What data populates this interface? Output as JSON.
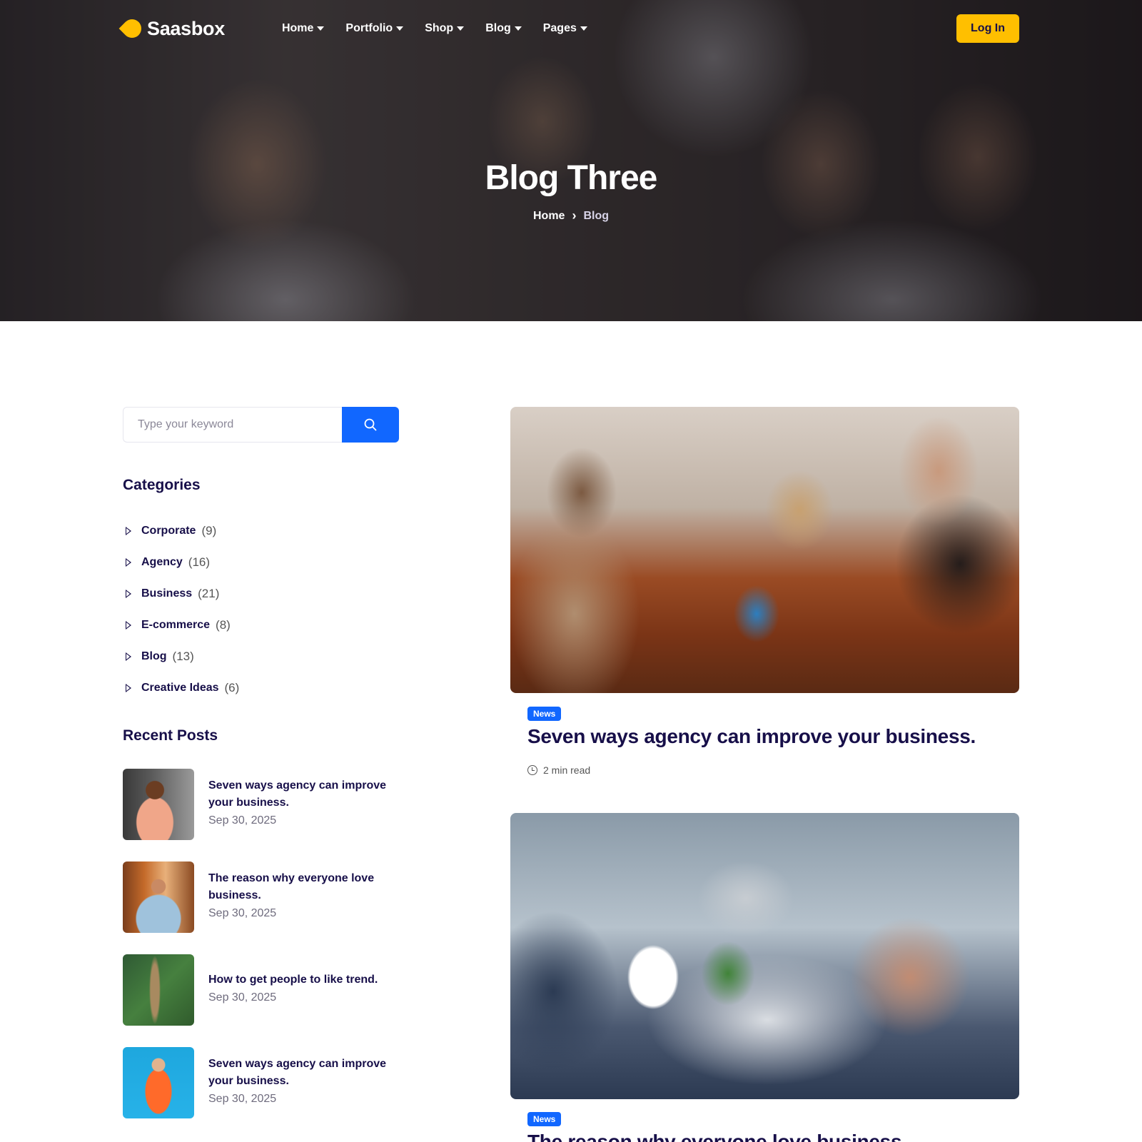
{
  "header": {
    "logo_text": "Saasbox",
    "nav": [
      {
        "label": "Home"
      },
      {
        "label": "Portfolio"
      },
      {
        "label": "Shop"
      },
      {
        "label": "Blog"
      },
      {
        "label": "Pages"
      }
    ],
    "login_label": "Log In"
  },
  "hero": {
    "title": "Blog Three",
    "breadcrumb": {
      "home": "Home",
      "separator": "›",
      "current": "Blog"
    }
  },
  "sidebar": {
    "search": {
      "placeholder": "Type your keyword",
      "value": "",
      "icon": "search-icon"
    },
    "categories_heading": "Categories",
    "categories": [
      {
        "name": "Corporate",
        "count": "(9)"
      },
      {
        "name": "Agency",
        "count": "(16)"
      },
      {
        "name": "Business",
        "count": "(21)"
      },
      {
        "name": "E-commerce",
        "count": "(8)"
      },
      {
        "name": "Blog",
        "count": "(13)"
      },
      {
        "name": "Creative Ideas",
        "count": "(6)"
      }
    ],
    "recent_heading": "Recent Posts",
    "recent_posts": [
      {
        "title": "Seven ways agency can improve your business.",
        "date": "Sep 30, 2025"
      },
      {
        "title": "The reason why everyone love business.",
        "date": "Sep 30, 2025"
      },
      {
        "title": "How to get people to like trend.",
        "date": "Sep 30, 2025"
      },
      {
        "title": "Seven ways agency can improve your business.",
        "date": "Sep 30, 2025"
      }
    ]
  },
  "posts": [
    {
      "badge": "News",
      "title": "Seven ways agency can improve your business.",
      "read_time": "2 min read"
    },
    {
      "badge": "News",
      "title": "The reason why everyone love business."
    }
  ],
  "colors": {
    "accent": "#1167ff",
    "brand": "#ffbf00",
    "heading": "#170f49"
  }
}
